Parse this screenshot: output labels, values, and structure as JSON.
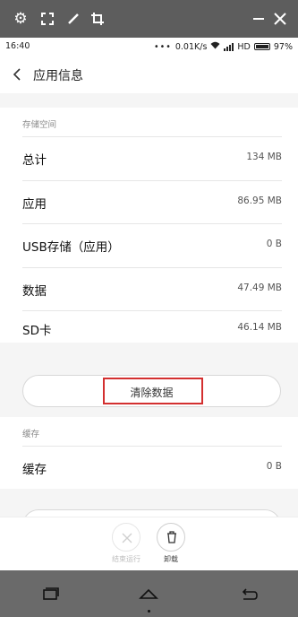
{
  "emulator_toolbar": {
    "icons": [
      "gear-icon",
      "expand-icon",
      "pencil-icon",
      "crop-icon",
      "minimize-icon",
      "close-icon"
    ]
  },
  "status_bar": {
    "time": "16:40",
    "dots": "•••",
    "network_speed": "0.01K/s",
    "network": "HD",
    "battery": "97%"
  },
  "header": {
    "title": "应用信息"
  },
  "storage": {
    "section_label": "存储空间",
    "rows": [
      {
        "label": "总计",
        "value": "134 MB"
      },
      {
        "label": "应用",
        "value": "86.95 MB"
      },
      {
        "label": "USB存储（应用）",
        "value": "0 B"
      },
      {
        "label": "数据",
        "value": "47.49 MB"
      },
      {
        "label": "SD卡",
        "value": "46.14 MB"
      }
    ],
    "clear_data_label": "清除数据"
  },
  "cache": {
    "section_label": "缓存",
    "row": {
      "label": "缓存",
      "value": "0 B"
    }
  },
  "action_bar": {
    "force_stop_label": "结束运行",
    "uninstall_label": "卸载"
  },
  "nav_bar": {
    "icons": [
      "recents-icon",
      "home-icon",
      "back-icon"
    ]
  },
  "colors": {
    "highlight": "#d32f2f",
    "emulator_bar": "#5d5d5d",
    "nav_bar": "#6a6a6a"
  }
}
